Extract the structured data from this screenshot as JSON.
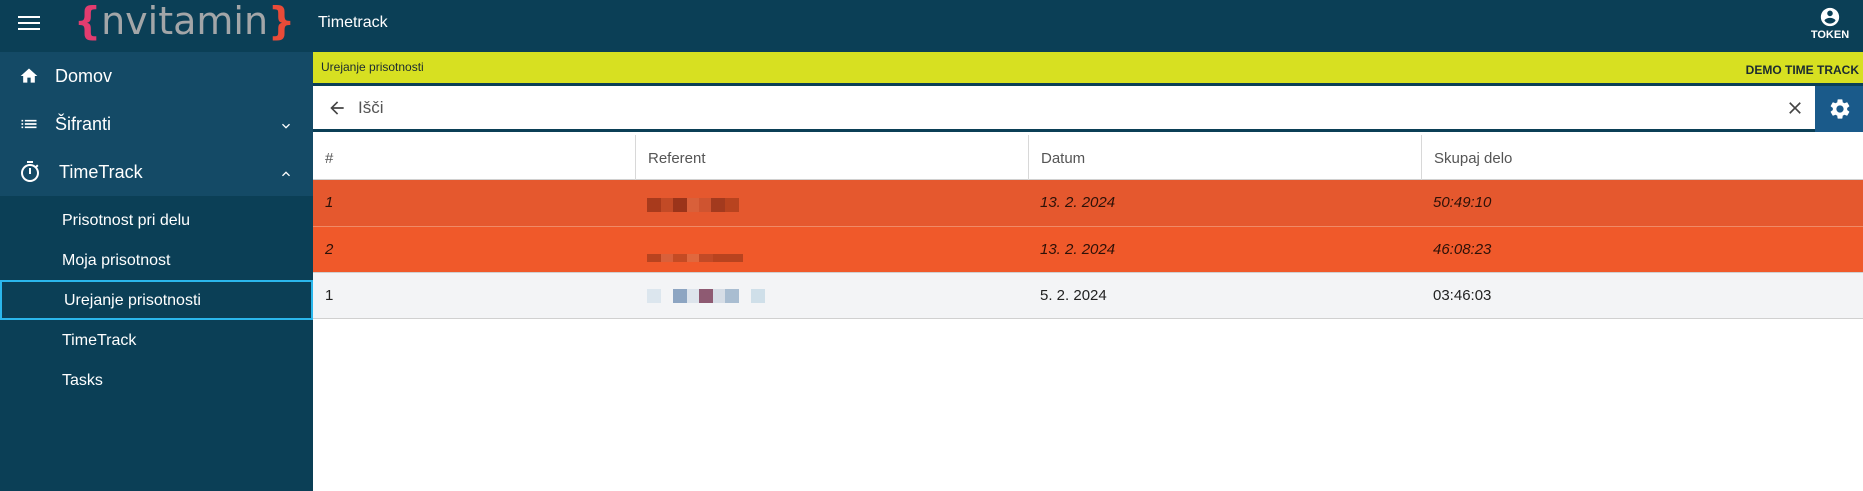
{
  "header": {
    "logo_text": "nvitamin",
    "app_title": "Timetrack",
    "account_label": "TOKEN",
    "icons": {
      "menu": "hamburger-menu-icon",
      "account": "account-circle-icon"
    }
  },
  "sidebar": {
    "items": [
      {
        "label": "Domov",
        "icon": "home-icon"
      },
      {
        "label": "Šifranti",
        "icon": "list-icon",
        "expanded": false
      },
      {
        "label": "TimeTrack",
        "icon": "timer-icon",
        "expanded": true
      }
    ],
    "subitems": [
      {
        "label": "Prisotnost pri delu"
      },
      {
        "label": "Moja prisotnost"
      },
      {
        "label": "Urejanje prisotnosti",
        "active": true
      },
      {
        "label": "TimeTrack"
      },
      {
        "label": "Tasks"
      }
    ]
  },
  "banner": {
    "page_title": "Urejanje prisotnosti",
    "company": "DEMO TIME TRACK"
  },
  "search": {
    "placeholder": "Išči",
    "value": ""
  },
  "table": {
    "columns": [
      "#",
      "Referent",
      "Datum",
      "Skupaj delo"
    ],
    "rows": [
      {
        "num": "1",
        "referent": "",
        "datum": "13. 2. 2024",
        "skupaj": "50:49:10",
        "highlight": "orange"
      },
      {
        "num": "2",
        "referent": "",
        "datum": "13. 2. 2024",
        "skupaj": "46:08:23",
        "highlight": "orange"
      },
      {
        "num": "1",
        "referent": "",
        "datum": "5. 2. 2024",
        "skupaj": "03:46:03",
        "highlight": "none"
      }
    ]
  },
  "colors": {
    "header_bg": "#0b3f56",
    "banner_bg": "#d7e021",
    "row_highlight": "#f0592a",
    "active_border": "#2bb7ec",
    "settings_bg": "#1a5a8a"
  }
}
